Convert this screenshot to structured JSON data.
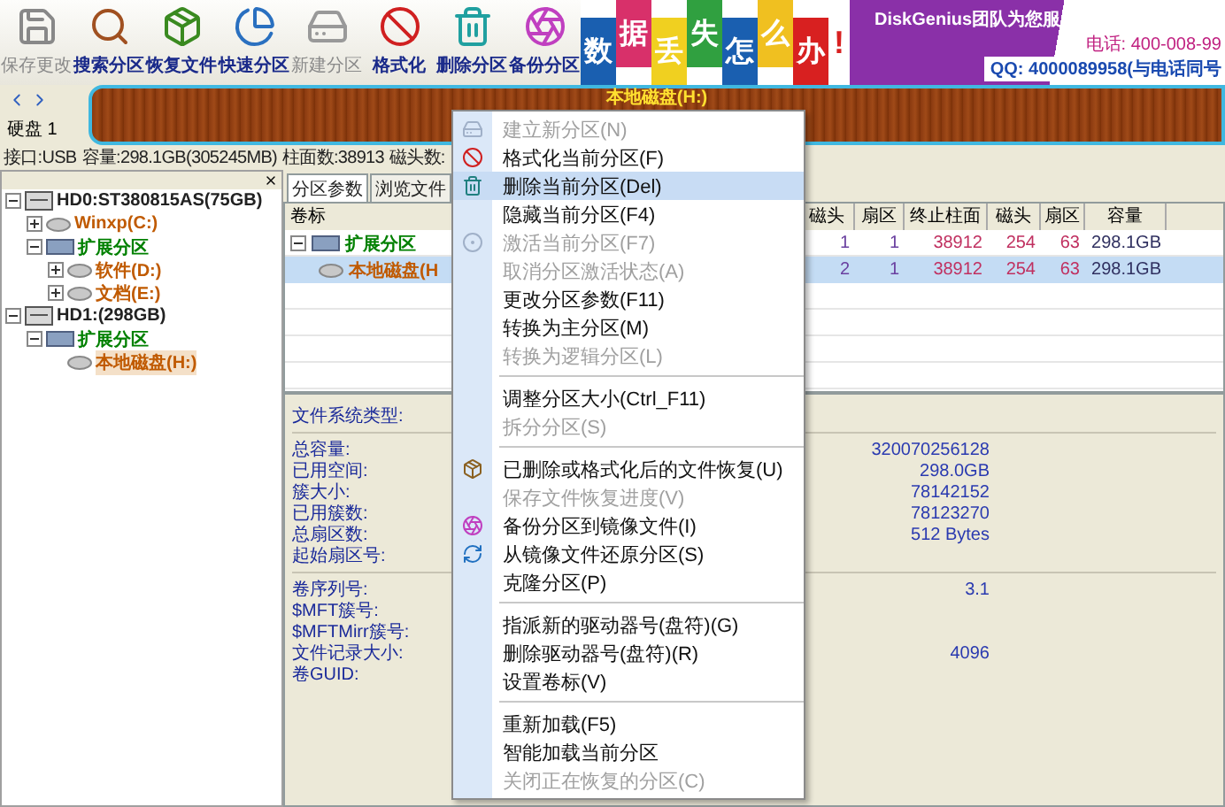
{
  "toolbar": {
    "buttons": [
      {
        "label": "保存更改",
        "disabled": true
      },
      {
        "label": "搜索分区",
        "disabled": false
      },
      {
        "label": "恢复文件",
        "disabled": false
      },
      {
        "label": "快速分区",
        "disabled": false
      },
      {
        "label": "新建分区",
        "disabled": true
      },
      {
        "label": "格式化",
        "disabled": false
      },
      {
        "label": "删除分区",
        "disabled": false
      },
      {
        "label": "备份分区",
        "disabled": false
      }
    ]
  },
  "banner": {
    "tiles": [
      {
        "text": "数",
        "color": "#1a5fb0"
      },
      {
        "text": "据",
        "color": "#d8306a"
      },
      {
        "text": "丢",
        "color": "#f0d020"
      },
      {
        "text": "失",
        "color": "#30a040"
      },
      {
        "text": "怎",
        "color": "#1a5fb0"
      },
      {
        "text": "么",
        "color": "#f0c020"
      },
      {
        "text": "办",
        "color": "#d82020"
      }
    ],
    "mark": "!",
    "slogan": "DiskGenius团队为您服",
    "phone": "电话: 400-008-99",
    "qq": "QQ: 4000089958(与电话同号"
  },
  "disk_bar": {
    "disk_label": "硬盘 1",
    "partition": "本地磁盘(H:)"
  },
  "disk_info": [
    "接口:USB",
    "容量:298.1GB(305245MB)",
    "柱面数:38913",
    "磁头数:"
  ],
  "tree": [
    {
      "label": "HD0:ST380815AS(75GB)",
      "kind": "disk",
      "expanded": true,
      "selected": false,
      "children": [
        {
          "label": "Winxp(C:)",
          "kind": "partition",
          "expanded": false,
          "selected": false
        },
        {
          "label": "扩展分区",
          "kind": "extended",
          "expanded": true,
          "selected": false,
          "children": [
            {
              "label": "软件(D:)",
              "kind": "partition",
              "expanded": false,
              "selected": false
            },
            {
              "label": "文档(E:)",
              "kind": "partition",
              "expanded": false,
              "selected": false
            }
          ]
        }
      ]
    },
    {
      "label": "HD1:(298GB)",
      "kind": "disk",
      "expanded": true,
      "selected": false,
      "children": [
        {
          "label": "扩展分区",
          "kind": "extended",
          "expanded": true,
          "selected": false,
          "children": [
            {
              "label": "本地磁盘(H:)",
              "kind": "partition",
              "selected": true
            }
          ]
        }
      ]
    }
  ],
  "tabs": [
    {
      "label": "分区参数",
      "selected": true
    },
    {
      "label": "浏览文件",
      "selected": false
    }
  ],
  "table": {
    "columns": [
      "卷标",
      "磁头",
      "扇区",
      "终止柱面",
      "磁头",
      "扇区",
      "容量"
    ],
    "rows": [
      {
        "kind": "extended",
        "expanded": true,
        "selected": false,
        "cells": [
          "扩展分区",
          "1",
          "1",
          "38912",
          "254",
          "63",
          "298.1GB"
        ]
      },
      {
        "kind": "partition",
        "selected": true,
        "cells": [
          "本地磁盘(H",
          "2",
          "1",
          "38912",
          "254",
          "63",
          "298.1GB"
        ]
      }
    ]
  },
  "details": [
    [
      {
        "label": "文件系统类型:"
      }
    ],
    [
      {
        "label": "总容量:",
        "value": "320070256128"
      },
      {
        "label": "已用空间:",
        "value": "298.0GB"
      },
      {
        "label": "簇大小:",
        "value": "78142152"
      },
      {
        "label": "已用簇数:",
        "value": "78123270"
      },
      {
        "label": "总扇区数:",
        "value": "512 Bytes"
      },
      {
        "label": "起始扇区号:"
      }
    ],
    [
      {
        "label": "卷序列号:",
        "value": "3.1"
      },
      {
        "label": "$MFT簇号:"
      },
      {
        "label": "$MFTMirr簇号:"
      },
      {
        "label": "文件记录大小:",
        "value": "4096"
      },
      {
        "label": "卷GUID:"
      }
    ]
  ],
  "context_menu": [
    {
      "kind": "item",
      "label": "建立新分区(N)",
      "disabled": true,
      "selected": false
    },
    {
      "kind": "item",
      "label": "格式化当前分区(F)",
      "disabled": false,
      "selected": false
    },
    {
      "kind": "item",
      "label": "删除当前分区(Del)",
      "disabled": false,
      "selected": true
    },
    {
      "kind": "item",
      "label": "隐藏当前分区(F4)",
      "disabled": false,
      "selected": false
    },
    {
      "kind": "item",
      "label": "激活当前分区(F7)",
      "disabled": true,
      "selected": false
    },
    {
      "kind": "item",
      "label": "取消分区激活状态(A)",
      "disabled": true,
      "selected": false
    },
    {
      "kind": "item",
      "label": "更改分区参数(F11)",
      "disabled": false,
      "selected": false
    },
    {
      "kind": "item",
      "label": "转换为主分区(M)",
      "disabled": false,
      "selected": false
    },
    {
      "kind": "item",
      "label": "转换为逻辑分区(L)",
      "disabled": true,
      "selected": false
    },
    {
      "kind": "separator"
    },
    {
      "kind": "item",
      "label": "调整分区大小(Ctrl_F11)",
      "disabled": false,
      "selected": false
    },
    {
      "kind": "item",
      "label": "拆分分区(S)",
      "disabled": true,
      "selected": false
    },
    {
      "kind": "separator"
    },
    {
      "kind": "item",
      "label": "已删除或格式化后的文件恢复(U)",
      "disabled": false,
      "selected": false
    },
    {
      "kind": "item",
      "label": "保存文件恢复进度(V)",
      "disabled": true,
      "selected": false
    },
    {
      "kind": "item",
      "label": "备份分区到镜像文件(I)",
      "disabled": false,
      "selected": false
    },
    {
      "kind": "item",
      "label": "从镜像文件还原分区(S)",
      "disabled": false,
      "selected": false
    },
    {
      "kind": "item",
      "label": "克隆分区(P)",
      "disabled": false,
      "selected": false
    },
    {
      "kind": "separator"
    },
    {
      "kind": "item",
      "label": "指派新的驱动器号(盘符)(G)",
      "disabled": false,
      "selected": false
    },
    {
      "kind": "item",
      "label": "删除驱动器号(盘符)(R)",
      "disabled": false,
      "selected": false
    },
    {
      "kind": "item",
      "label": "设置卷标(V)",
      "disabled": false,
      "selected": false
    },
    {
      "kind": "separator"
    },
    {
      "kind": "item",
      "label": "重新加载(F5)",
      "disabled": false,
      "selected": false
    },
    {
      "kind": "item",
      "label": "智能加载当前分区",
      "disabled": false,
      "selected": false
    },
    {
      "kind": "item",
      "label": "关闭正在恢复的分区(C)",
      "disabled": true,
      "selected": false
    }
  ]
}
